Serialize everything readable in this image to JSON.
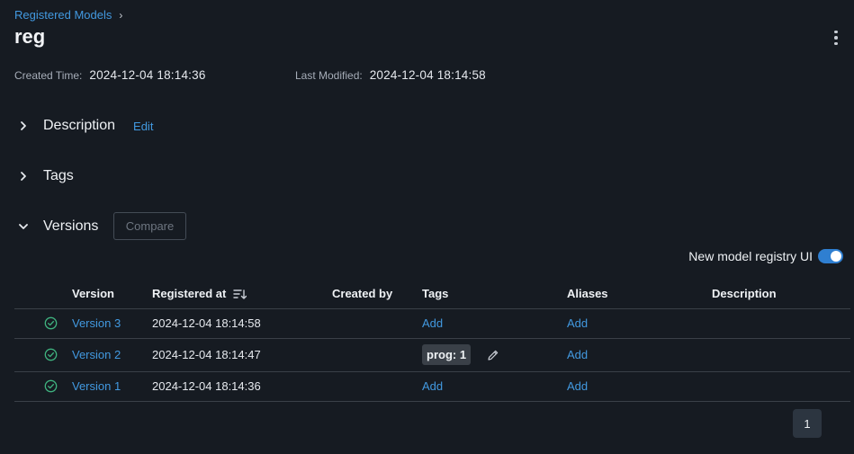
{
  "breadcrumb": {
    "link": "Registered Models",
    "separator": "›"
  },
  "title": "reg",
  "meta": {
    "created_label": "Created Time:",
    "created_value": "2024-12-04 18:14:36",
    "modified_label": "Last Modified:",
    "modified_value": "2024-12-04 18:14:58"
  },
  "sections": {
    "description": {
      "label": "Description",
      "edit": "Edit"
    },
    "tags": {
      "label": "Tags"
    },
    "versions": {
      "label": "Versions",
      "compare": "Compare"
    }
  },
  "toggle": {
    "label": "New model registry UI",
    "on": true
  },
  "table": {
    "headers": {
      "version": "Version",
      "registered_at": "Registered at",
      "created_by": "Created by",
      "tags": "Tags",
      "aliases": "Aliases",
      "description": "Description"
    },
    "rows": [
      {
        "version": "Version 3",
        "registered_at": "2024-12-04 18:14:58",
        "created_by": "",
        "tag": "",
        "tags_add": "Add",
        "aliases": "Add",
        "description": ""
      },
      {
        "version": "Version 2",
        "registered_at": "2024-12-04 18:14:47",
        "created_by": "",
        "tag": "prog: 1",
        "tags_add": "",
        "aliases": "Add",
        "description": ""
      },
      {
        "version": "Version 1",
        "registered_at": "2024-12-04 18:14:36",
        "created_by": "",
        "tag": "",
        "tags_add": "Add",
        "aliases": "Add",
        "description": ""
      }
    ]
  },
  "pagination": {
    "current": "1"
  },
  "colors": {
    "link": "#4299e0",
    "status_ok": "#3fb27f",
    "toggle_on": "#2f7fd1",
    "background": "#161b22"
  }
}
